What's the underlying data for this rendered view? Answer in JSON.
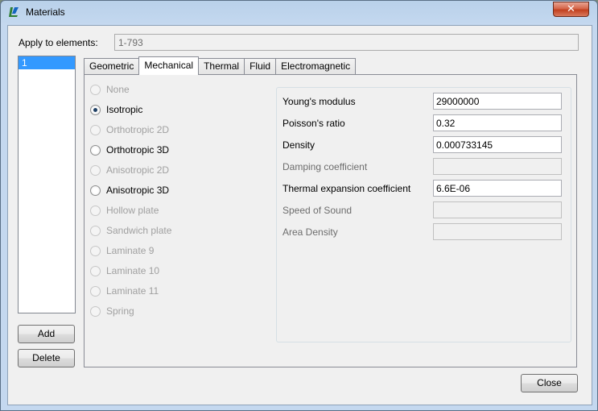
{
  "window": {
    "title": "Materials",
    "close_glyph": "✕"
  },
  "apply": {
    "label": "Apply to elements:",
    "value": "1-793"
  },
  "materials_list": {
    "items": [
      "1"
    ]
  },
  "buttons": {
    "add": "Add",
    "delete": "Delete",
    "close": "Close"
  },
  "tabs": [
    {
      "label": "Geometric",
      "active": false
    },
    {
      "label": "Mechanical",
      "active": true
    },
    {
      "label": "Thermal",
      "active": false
    },
    {
      "label": "Fluid",
      "active": false
    },
    {
      "label": "Electromagnetic",
      "active": false
    }
  ],
  "material_types": [
    {
      "label": "None",
      "enabled": false,
      "checked": false
    },
    {
      "label": "Isotropic",
      "enabled": true,
      "checked": true
    },
    {
      "label": "Orthotropic 2D",
      "enabled": false,
      "checked": false
    },
    {
      "label": "Orthotropic 3D",
      "enabled": true,
      "checked": false
    },
    {
      "label": "Anisotropic 2D",
      "enabled": false,
      "checked": false
    },
    {
      "label": "Anisotropic 3D",
      "enabled": true,
      "checked": false
    },
    {
      "label": "Hollow plate",
      "enabled": false,
      "checked": false
    },
    {
      "label": "Sandwich plate",
      "enabled": false,
      "checked": false
    },
    {
      "label": "Laminate 9",
      "enabled": false,
      "checked": false
    },
    {
      "label": "Laminate 10",
      "enabled": false,
      "checked": false
    },
    {
      "label": "Laminate 11",
      "enabled": false,
      "checked": false
    },
    {
      "label": "Spring",
      "enabled": false,
      "checked": false
    }
  ],
  "properties": [
    {
      "label": "Young's modulus",
      "value": "29000000",
      "enabled": true
    },
    {
      "label": "Poisson's ratio",
      "value": "0.32",
      "enabled": true
    },
    {
      "label": "Density",
      "value": "0.000733145",
      "enabled": true
    },
    {
      "label": "Damping coefficient",
      "value": "",
      "enabled": false
    },
    {
      "label": "Thermal expansion coefficient",
      "value": "6.6E-06",
      "enabled": true
    },
    {
      "label": "Speed of Sound",
      "value": "",
      "enabled": false
    },
    {
      "label": "Area Density",
      "value": "",
      "enabled": false
    }
  ]
}
